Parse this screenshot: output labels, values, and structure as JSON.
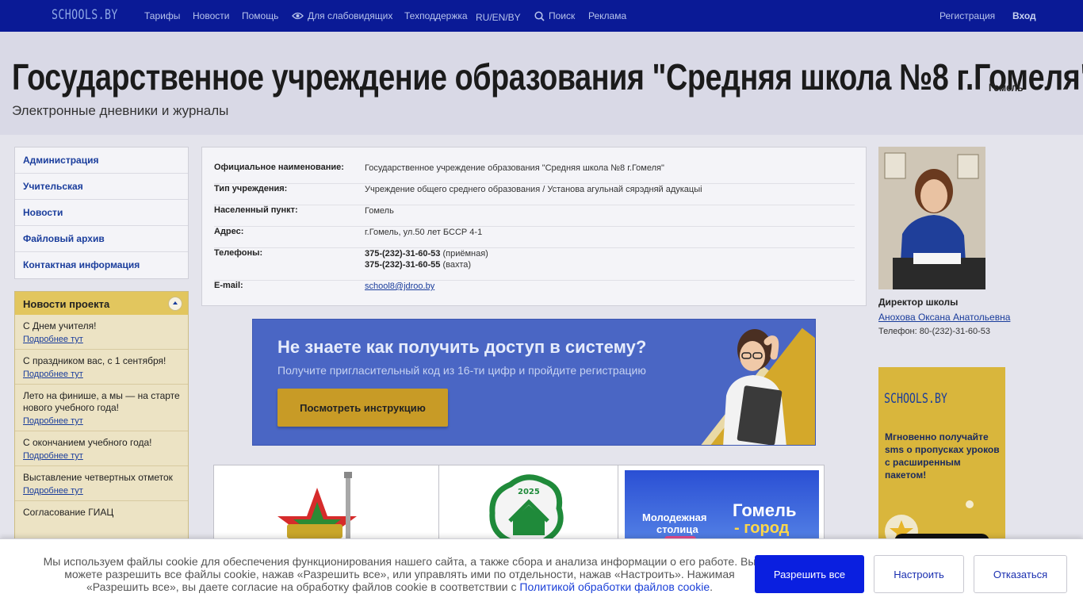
{
  "nav": {
    "logo": "SCHOOLS.BY",
    "items": [
      "Тарифы",
      "Новости",
      "Помощь",
      "Для слабовидящих",
      "Техподдержка",
      "RU/EN/BY",
      "Поиск",
      "Реклама"
    ],
    "register": "Регистрация",
    "login": "Вход"
  },
  "header": {
    "title": "Государственное учреждение образования \"Средняя школа №8 г.Гомеля\"",
    "city": "Гомель",
    "subtitle": "Электронные дневники и журналы"
  },
  "sidebar": {
    "menu": [
      "Администрация",
      "Учительская",
      "Новости",
      "Файловый архив",
      "Контактная информация"
    ],
    "news_title": "Новости проекта",
    "more_label": "Подробнее тут",
    "news": [
      "С Днем учителя!",
      "С праздником вас, с 1 сентября!",
      "Лето на финише, а мы — на старте нового учебного года!",
      "С окончанием учебного года!",
      "Выставление четвертных отметок",
      "Согласование ГИАЦ"
    ]
  },
  "info": {
    "rows": [
      {
        "label": "Официальное наименование:",
        "value": "Государственное учреждение образования \"Средняя школа №8 г.Гомеля\""
      },
      {
        "label": "Тип учреждения:",
        "value": "Учреждение общего среднего образования / Установа агульнай сярэдняй адукацыі"
      },
      {
        "label": "Населенный пункт:",
        "value": "Гомель"
      },
      {
        "label": "Адрес:",
        "value": "г.Гомель, ул.50 лет БССР 4-1"
      }
    ],
    "phones_label": "Телефоны:",
    "phones": [
      {
        "number": "375-(232)-31-60-53",
        "note": "(приёмная)"
      },
      {
        "number": "375-(232)-31-60-55",
        "note": "(вахта)"
      }
    ],
    "email_label": "E-mail:",
    "email": "school8@jdroo.by"
  },
  "banner": {
    "title": "Не знаете как получить доступ в систему?",
    "subtitle": "Получите пригласительный код из 16-ти цифр и пройдите регистрацию",
    "button": "Посмотреть инструкцию"
  },
  "logos": {
    "badge_year": "2025",
    "city_line1": "Молодежная",
    "city_line2": "столица",
    "city_right1": "Гомель",
    "city_right2": "- город"
  },
  "director": {
    "title": "Директор школы",
    "name": "Анохова Оксана Анатольевна",
    "phone": "Телефон: 80-(232)-31-60-53"
  },
  "ad": {
    "logo": "SCHOOLS.BY",
    "text": "Мгновенно получайте sms о пропусках уроков с расширенным пакетом!"
  },
  "cookie": {
    "text": "Мы используем файлы cookie для обеспечения функционирования нашего сайта, а также сбора и анализа информации о его работе. Вы можете разрешить все файлы cookie, нажав «Разрешить все», или управлять ими по отдельности, нажав «Настроить». Нажимая «Разрешить все», вы даете согласие на обработку файлов cookie в соответствии с",
    "link": "Политикой обработки файлов cookie",
    "accept": "Разрешить все",
    "settings": "Настроить",
    "decline": "Отказаться"
  }
}
